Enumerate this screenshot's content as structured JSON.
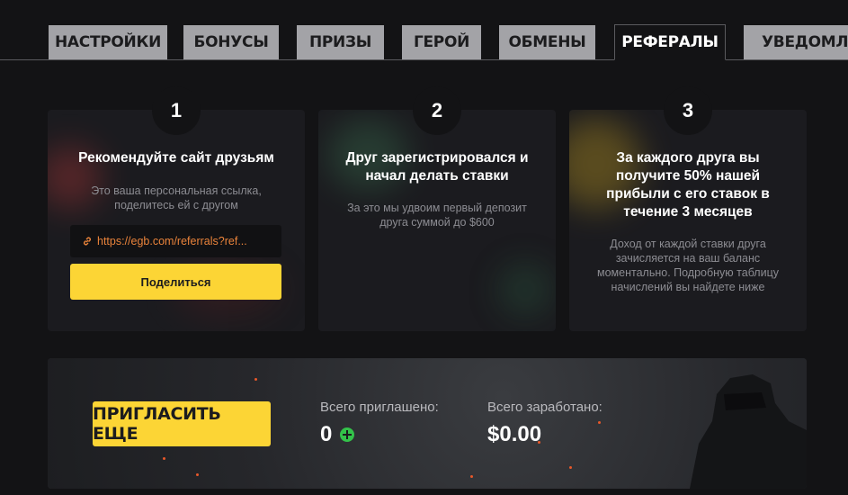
{
  "tabs": [
    {
      "label": "НАСТРОЙКИ"
    },
    {
      "label": "БОНУСЫ"
    },
    {
      "label": "ПРИЗЫ"
    },
    {
      "label": "ГЕРОЙ"
    },
    {
      "label": "ОБМЕНЫ"
    },
    {
      "label": "РЕФЕРАЛЫ",
      "active": true
    },
    {
      "label": "УВЕДОМЛЕН"
    }
  ],
  "steps": [
    {
      "number": "1",
      "title": "Рекомендуйте сайт друзьям",
      "description": "Это ваша персональная ссылка, поделитесь ей с другом",
      "link": "https://egb.com/referrals?ref...",
      "share_label": "Поделиться"
    },
    {
      "number": "2",
      "title": "Друг зарегистрировался и начал делать ставки",
      "description": "За это мы удвоим первый депозит друга суммой до $600"
    },
    {
      "number": "3",
      "title": "За каждого друга вы получите 50% нашей прибыли с его ставок в течение 3 месяцев",
      "description": "Доход от каждой ставки друга зачисляется на ваш баланс моментально. Подробную таблицу начислений вы найдете ниже"
    }
  ],
  "banner": {
    "invite_label": "ПРИГЛАСИТЬ ЕЩЕ",
    "invited_label": "Всего приглашено:",
    "invited_value": "0",
    "earned_label": "Всего заработано:",
    "earned_value": "$0.00"
  },
  "colors": {
    "accent": "#fcd535",
    "link": "#e9833b",
    "success": "#33c24a",
    "background": "#131315",
    "card": "#1b1b1f"
  },
  "icons": [
    "link-icon",
    "plus-circle-icon"
  ]
}
